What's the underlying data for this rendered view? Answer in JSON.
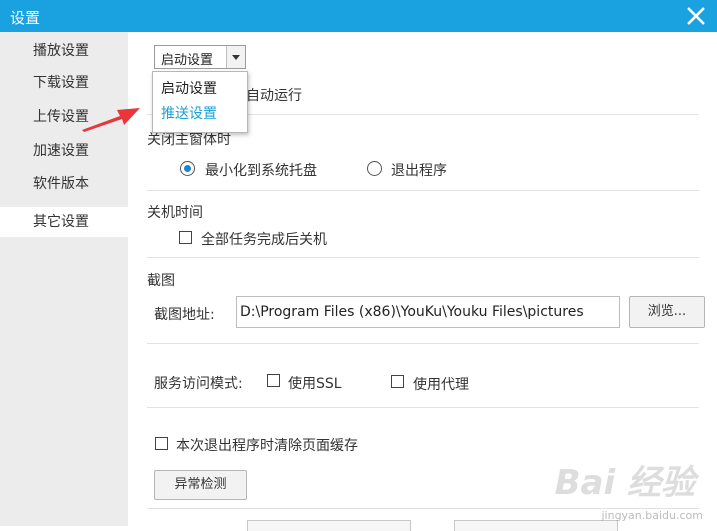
{
  "window": {
    "title": "设置"
  },
  "sidebar": {
    "items": [
      {
        "label": "播放设置"
      },
      {
        "label": "下载设置"
      },
      {
        "label": "上传设置"
      },
      {
        "label": "加速设置"
      },
      {
        "label": "软件版本"
      },
      {
        "label": "其它设置"
      }
    ]
  },
  "combo": {
    "value": "启动设置"
  },
  "dropdown": {
    "options": [
      "启动设置",
      "推送设置"
    ]
  },
  "startup": {
    "autorun_text": "自动运行"
  },
  "close_main": {
    "title": "关闭主窗体时",
    "option_minimize": "最小化到系统托盘",
    "option_exit": "退出程序"
  },
  "shutdown": {
    "title": "关机时间",
    "checkbox_label": "全部任务完成后关机"
  },
  "screenshot": {
    "title": "截图",
    "address_label": "截图地址:",
    "address_value": "D:\\Program Files (x86)\\YouKu\\Youku Files\\pictures",
    "browse_label": "浏览..."
  },
  "service": {
    "label": "服务访问模式:",
    "ssl_label": "使用SSL",
    "proxy_label": "使用代理"
  },
  "cache": {
    "clear_label": "本次退出程序时清除页面缓存"
  },
  "diagnostic": {
    "button_label": "异常检测"
  },
  "watermark": {
    "big": "Bai 经验",
    "small": "jingyan.baidu.com"
  },
  "colors": {
    "titlebar": "#1aa1e0",
    "sidebar": "#ececec",
    "highlight": "#1a9fd8",
    "arrow": "#e8363a"
  }
}
